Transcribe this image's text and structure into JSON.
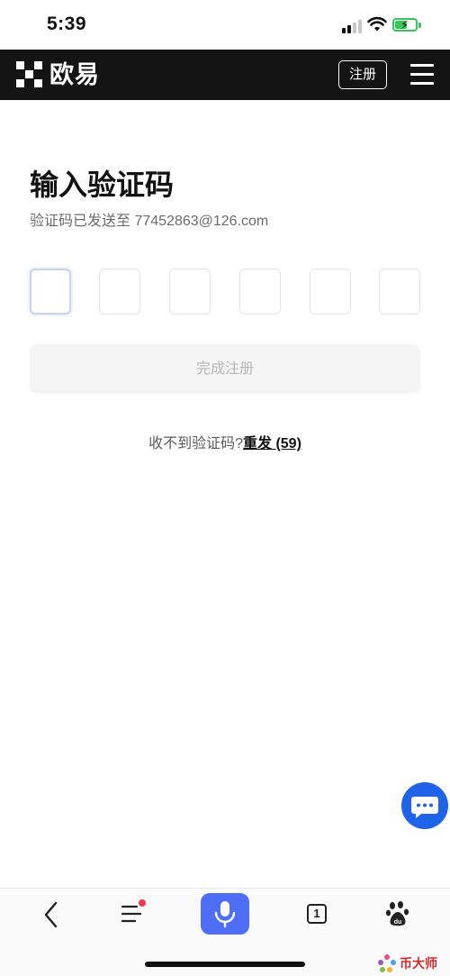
{
  "status_bar": {
    "time": "5:39",
    "icons": [
      "signal-icon",
      "wifi-icon",
      "battery-charging-icon"
    ]
  },
  "header": {
    "logo_text": "欧易",
    "register_label": "注册",
    "menu_icon": "hamburger-icon"
  },
  "main": {
    "title": "输入验证码",
    "subtitle": "验证码已发送至 77452863@126.com",
    "code_inputs": [
      "",
      "",
      "",
      "",
      "",
      ""
    ],
    "submit_label": "完成注册",
    "resend_prompt": "收不到验证码?",
    "resend_label": "重发 (59)"
  },
  "chat_fab": {
    "icon": "chat-icon"
  },
  "bottom_nav": {
    "items": [
      "back-icon",
      "menu-icon",
      "microphone-icon",
      "tabs-icon",
      "baidu-paw-icon"
    ],
    "tab_count": "1"
  },
  "watermark": {
    "text": "币大师"
  },
  "colors": {
    "header_bg": "#141414",
    "accent": "#1f63e8",
    "voice_button": "#4f6ef7",
    "notification_dot": "#ec3a4a"
  }
}
